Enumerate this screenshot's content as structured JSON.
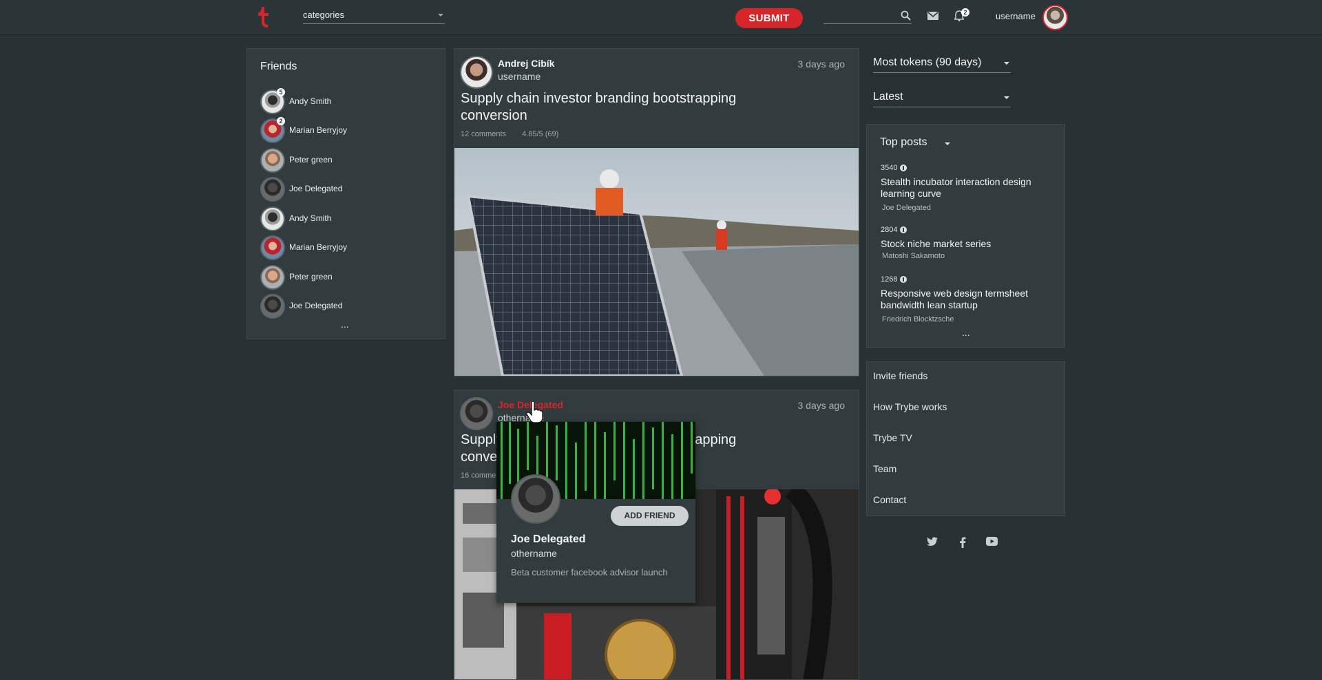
{
  "header": {
    "categories_label": "categories",
    "submit_label": "SUBMIT",
    "search_placeholder": "",
    "notification_count": "2",
    "username": "username"
  },
  "friends": {
    "title": "Friends",
    "items": [
      {
        "name": "Andy Smith",
        "badge": "5"
      },
      {
        "name": "Marian Berryjoy",
        "badge": "2"
      },
      {
        "name": "Peter green",
        "badge": ""
      },
      {
        "name": "Joe Delegated",
        "badge": ""
      },
      {
        "name": "Andy Smith",
        "badge": ""
      },
      {
        "name": "Marian Berryjoy",
        "badge": ""
      },
      {
        "name": "Peter green",
        "badge": ""
      },
      {
        "name": "Joe Delegated",
        "badge": ""
      }
    ],
    "more": "..."
  },
  "posts": [
    {
      "author": "Andrej Cibík",
      "handle": "username",
      "time": "3 days ago",
      "title": "Supply chain investor branding bootstrapping conversion",
      "comments": "12 comments",
      "rating": "4.85/5 (69)"
    },
    {
      "author": "Joe Delegated",
      "handle": "othername",
      "time": "3 days ago",
      "title": "Supply chain investor branding bootstrapping conversion",
      "comments": "16 comments",
      "rating": ""
    }
  ],
  "hovercard": {
    "add_friend": "ADD FRIEND",
    "name": "Joe Delegated",
    "handle": "othername",
    "bio": "Beta customer facebook advisor launch"
  },
  "sidebar": {
    "dropdown1": "Most tokens (90 days)",
    "dropdown2": "Latest",
    "top_posts_title": "Top posts",
    "top_posts": [
      {
        "score": "3540",
        "title": "Stealth incubator interaction design learning curve",
        "author": "Joe Delegated"
      },
      {
        "score": "2804",
        "title": "Stock niche market series",
        "author": "Matoshi Sakamoto"
      },
      {
        "score": "1268",
        "title": "Responsive web design termsheet bandwidth lean startup",
        "author": "Friedrich Blocktzsche"
      }
    ],
    "top_posts_more": "...",
    "links": [
      "Invite friends",
      "How Trybe works",
      "Trybe TV",
      "Team",
      "Contact"
    ]
  },
  "colors": {
    "accent": "#d7262b",
    "background": "#283134",
    "panel": "#323c3f"
  }
}
